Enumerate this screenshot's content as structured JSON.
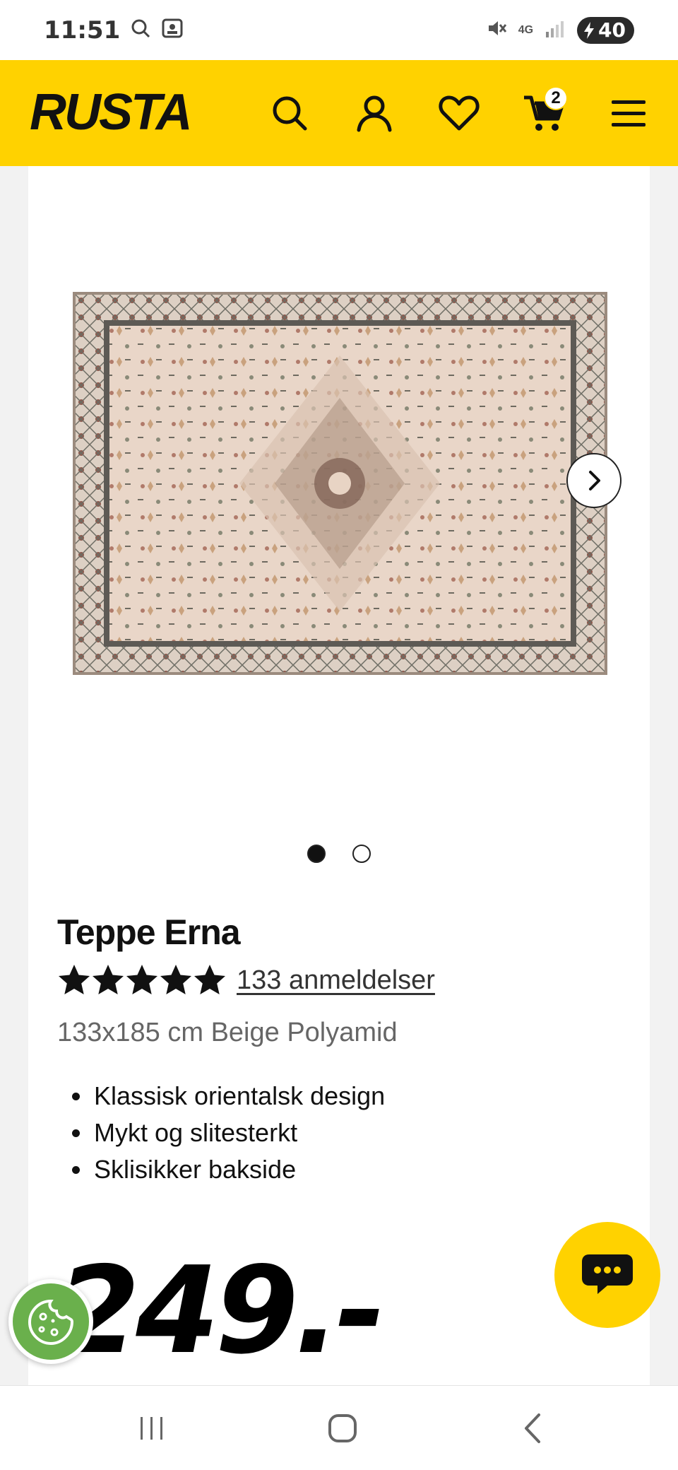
{
  "status_bar": {
    "time": "11:51",
    "network": "4G",
    "battery": "40"
  },
  "header": {
    "logo_text": "RUSTA",
    "cart_count": "2",
    "brand_color": "#ffd200"
  },
  "gallery": {
    "image_alt": "Teppe Erna",
    "total_images": 2,
    "active_index": 0
  },
  "product": {
    "title": "Teppe Erna",
    "rating_stars": 5,
    "reviews_label": "133 anmeldelser",
    "variant": "133x185 cm Beige Polyamid",
    "features": [
      "Klassisk orientalsk design",
      "Mykt og slitesterkt",
      "Sklisikker bakside"
    ],
    "price": "249.-"
  }
}
